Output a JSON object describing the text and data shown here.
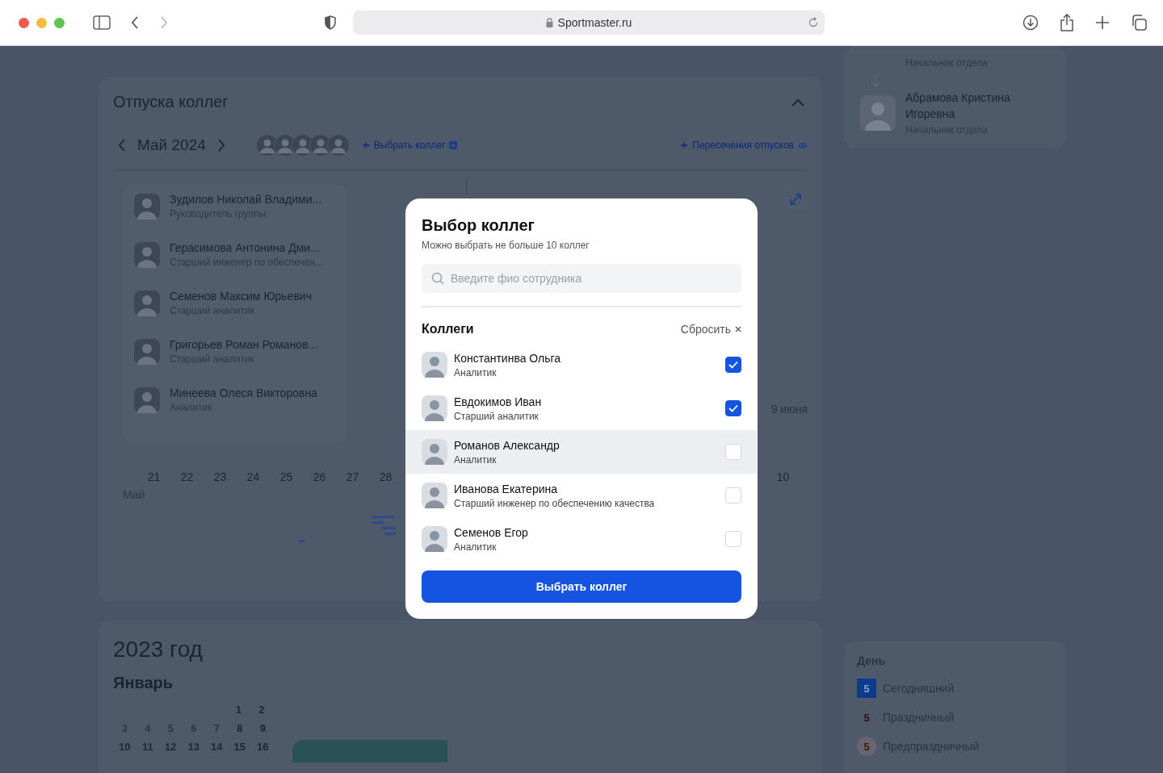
{
  "browser": {
    "url": "Sportmaster.ru"
  },
  "vacations": {
    "title": "Отпуска коллег",
    "month": "Май 2024",
    "pick_link": "Выбрать коллег",
    "overlap_link": "Пересечения отпусков",
    "people": [
      {
        "name": "Зудилов Николай Владими...",
        "role": "Руководитель группы"
      },
      {
        "name": "Герасимова Антонина Дми...",
        "role": "Старший инженер по обеспечен..."
      },
      {
        "name": "Семенов Максим Юрьевич",
        "role": "Старший аналитик"
      },
      {
        "name": "Григорьев Роман Романов...",
        "role": "Старший аналитик"
      },
      {
        "name": "Минеева Олеся Викторовна",
        "role": "Аналитик"
      }
    ],
    "side_date": "9 июня",
    "days": [
      "21",
      "22",
      "23",
      "24",
      "25",
      "26",
      "27",
      "28"
    ],
    "side_day": "10",
    "month_label": "Май"
  },
  "org": {
    "cut_role": "Начальник отдела",
    "person": {
      "name": "Абрамова Кристина Игоревна",
      "role": "Начальник отдела"
    }
  },
  "calendar": {
    "year": "2023 год",
    "month": "Январь",
    "weeks": [
      [
        "1",
        "2"
      ],
      [
        "3",
        "4",
        "5",
        "6",
        "7",
        "8",
        "9"
      ],
      [
        "10",
        "11",
        "12",
        "13",
        "14",
        "15",
        "16"
      ]
    ]
  },
  "legend": {
    "title": "День",
    "items": [
      {
        "kind": "today",
        "sample": "5",
        "label": "Сегодняшний"
      },
      {
        "kind": "holiday",
        "sample": "5",
        "label": "Праздничный"
      },
      {
        "kind": "preholiday",
        "sample": "5",
        "label": "Предпраздничный"
      }
    ]
  },
  "modal": {
    "title": "Выбор коллег",
    "subtitle": "Можно выбрать не больше 10 коллег",
    "search": {
      "placeholder": "Введите фио сотрудника"
    },
    "section": "Коллеги",
    "reset": "Сбросить",
    "colleagues": [
      {
        "name": "Константинва Ольга",
        "role": "Аналитик",
        "checked": true,
        "highlighted": false
      },
      {
        "name": "Евдокимов Иван",
        "role": "Старший аналитик",
        "checked": true,
        "highlighted": false
      },
      {
        "name": "Романов Александр",
        "role": "Аналитик",
        "checked": false,
        "highlighted": true
      },
      {
        "name": "Иванова Екатерина",
        "role": "Старший инженер по обеспечению качества",
        "checked": false,
        "highlighted": false
      },
      {
        "name": "Семенов Егор",
        "role": "Аналитик",
        "checked": false,
        "highlighted": false
      }
    ],
    "button": "Выбрать коллег"
  }
}
